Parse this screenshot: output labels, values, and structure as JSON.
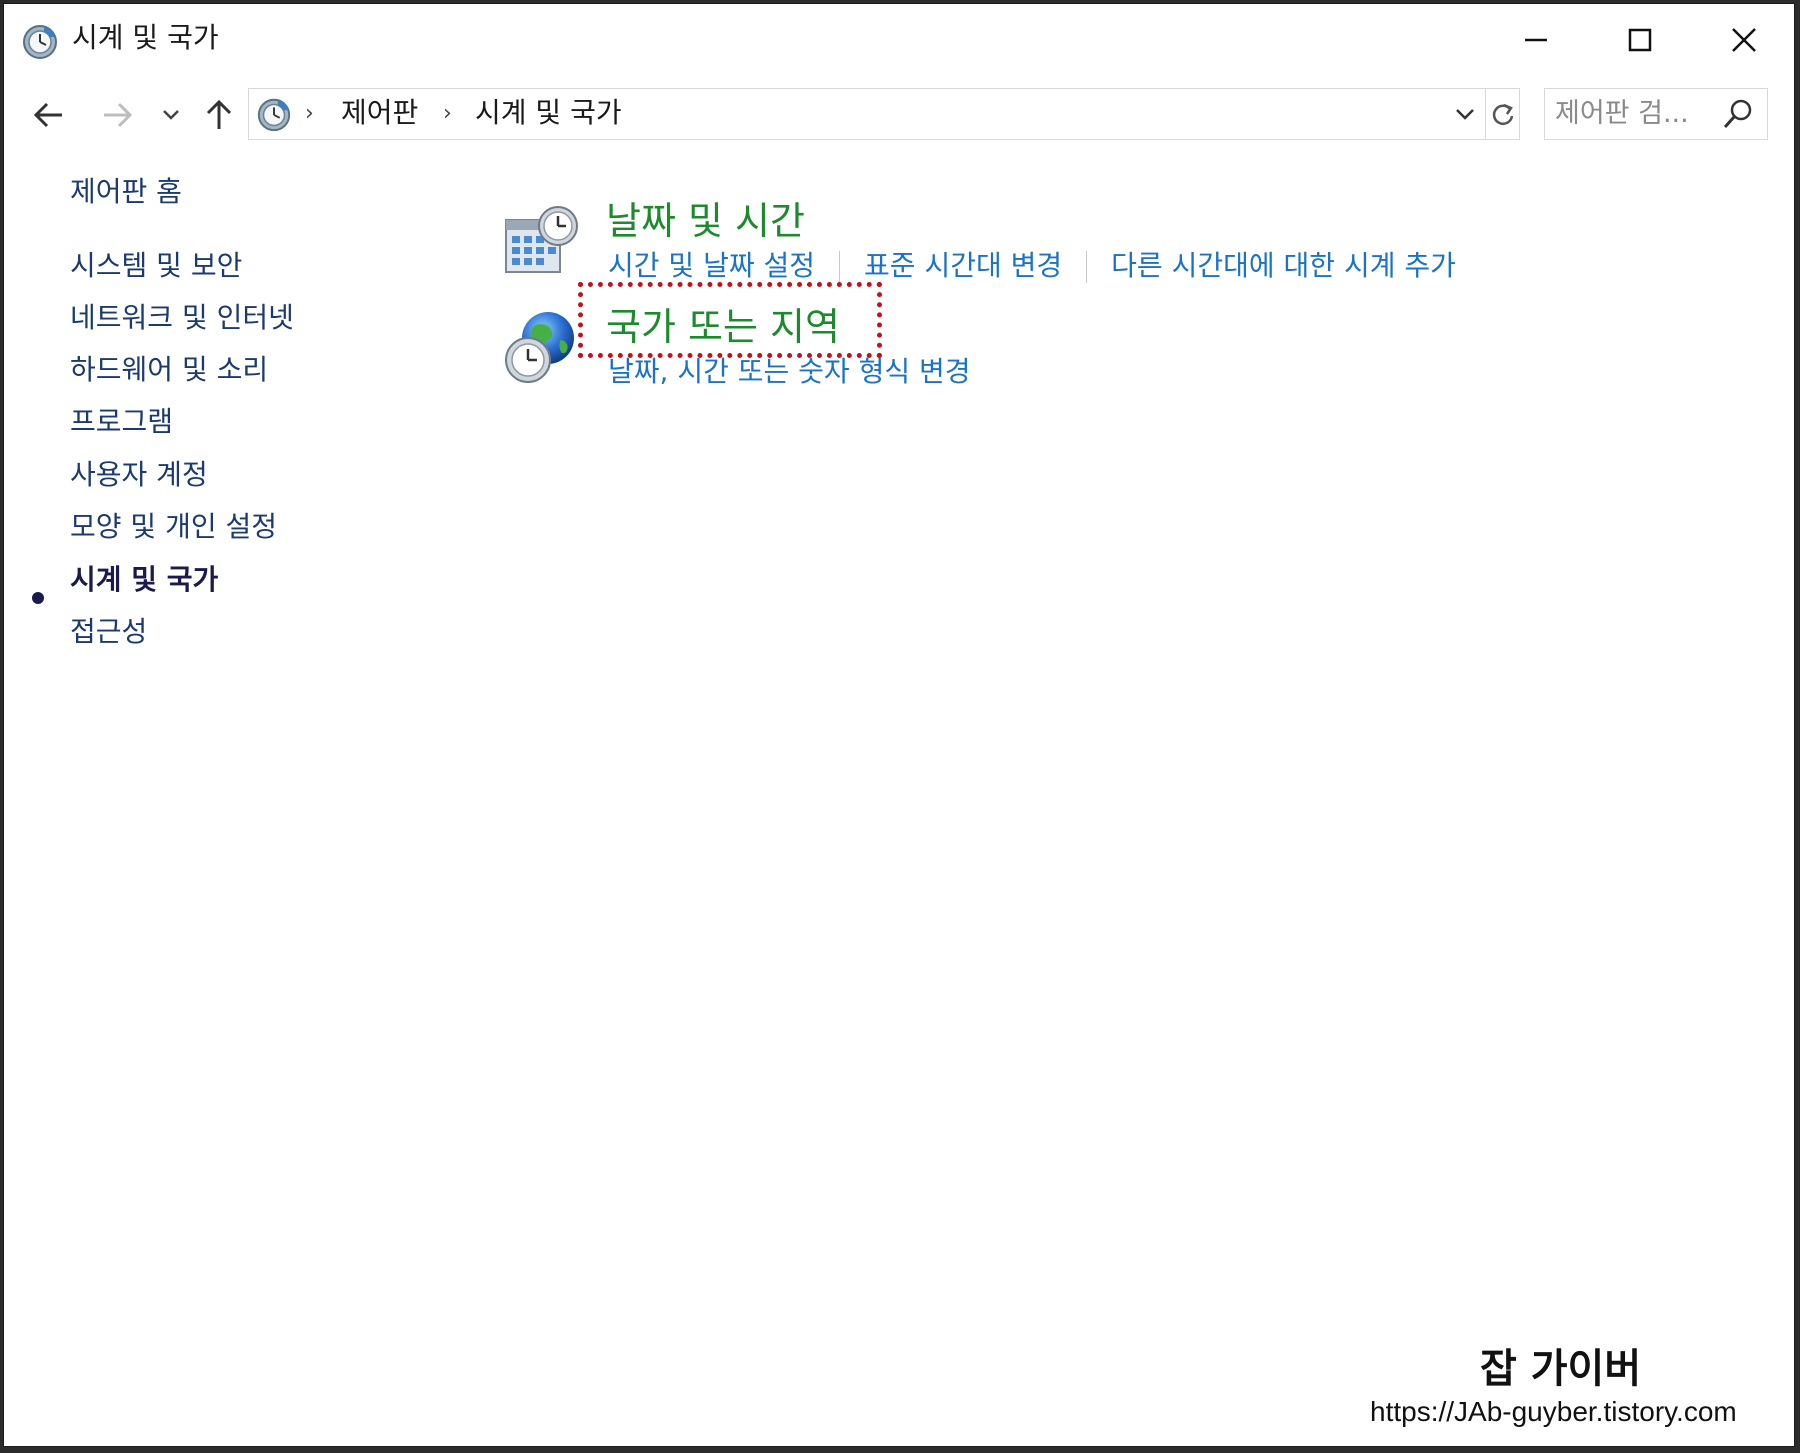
{
  "window": {
    "title": "시계 및 국가",
    "controls": {
      "minimize": "minimize-icon",
      "maximize": "maximize-icon",
      "close": "close-icon"
    }
  },
  "nav": {
    "icons": [
      "back-arrow-icon",
      "forward-arrow-icon",
      "chevron-down-icon",
      "up-arrow-icon",
      "refresh-icon"
    ],
    "breadcrumb": [
      "제어판",
      "시계 및 국가"
    ],
    "search_placeholder": "제어판 검..."
  },
  "sidebar": {
    "items": [
      {
        "label": "제어판 홈"
      },
      {
        "label": "시스템 및 보안"
      },
      {
        "label": "네트워크 및 인터넷"
      },
      {
        "label": "하드웨어 및 소리"
      },
      {
        "label": "프로그램"
      },
      {
        "label": "사용자 계정"
      },
      {
        "label": "모양 및 개인 설정"
      },
      {
        "label": "시계 및 국가",
        "current": true
      },
      {
        "label": "접근성"
      }
    ]
  },
  "categories": [
    {
      "title": "날짜 및 시간",
      "icon": "calendar-clock-icon",
      "links": [
        "시간 및 날짜 설정",
        "표준 시간대 변경",
        "다른 시간대에 대한 시계 추가"
      ]
    },
    {
      "title": "국가 또는 지역",
      "icon": "globe-clock-icon",
      "highlighted": true,
      "links": [
        "날짜, 시간 또는 숫자 형식 변경"
      ]
    }
  ],
  "colors": {
    "category_title": "#1e8a2e",
    "task_link": "#1a73c8",
    "sidebar_link": "#1b3a72",
    "highlight": "#c0121a"
  },
  "watermark": {
    "title": "잡 가이버",
    "url": "https://JAb-guyber.tistory.com"
  }
}
